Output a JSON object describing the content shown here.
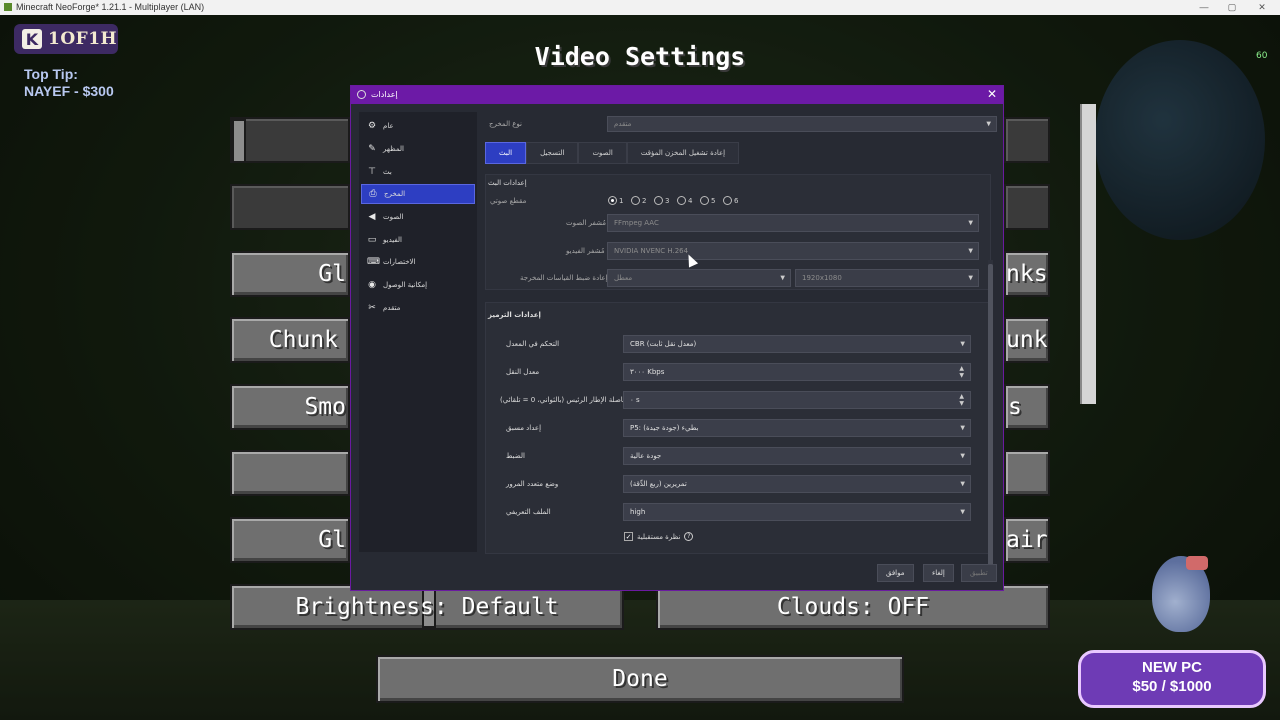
{
  "window": {
    "title": "Minecraft NeoForge* 1.21.1 - Multiplayer (LAN)",
    "controls": {
      "minimize": "—",
      "maximize": "▢",
      "close": "✕"
    }
  },
  "overlay": {
    "logo_text": "1OF1H",
    "top_tip_label": "Top Tip:",
    "top_tip_value": "NAYEF - $300",
    "fps": "60",
    "promo_line1": "NEW PC",
    "promo_line2": "$50 / $1000"
  },
  "minecraft": {
    "title": "Video Settings",
    "buttons": {
      "left_row3": "Gl",
      "right_row3": "nks",
      "left_row4": "Chunk",
      "right_row4": "unks",
      "left_row5": "Smo",
      "right_row5": "s",
      "left_row7": "Gl",
      "right_row7": "air",
      "brightness": "Brightness: Default",
      "clouds": "Clouds: OFF",
      "done": "Done"
    }
  },
  "dialog": {
    "title": "إعدادات",
    "close": "✕",
    "sidebar": [
      {
        "label": "عام",
        "icon": "gear-icon",
        "glyph": "⚙"
      },
      {
        "label": "المظهر",
        "icon": "brush-icon",
        "glyph": "✎"
      },
      {
        "label": "بث",
        "icon": "antenna-icon",
        "glyph": "⊤"
      },
      {
        "label": "المخرج",
        "icon": "output-icon",
        "glyph": "⎙"
      },
      {
        "label": "الصوت",
        "icon": "speaker-icon",
        "glyph": "◀"
      },
      {
        "label": "الفيديو",
        "icon": "monitor-icon",
        "glyph": "▭"
      },
      {
        "label": "الاختصارات",
        "icon": "keyboard-icon",
        "glyph": "⌨"
      },
      {
        "label": "إمكانية الوصول",
        "icon": "accessibility-icon",
        "glyph": "◉"
      },
      {
        "label": "متقدم",
        "icon": "tools-icon",
        "glyph": "✂"
      }
    ],
    "output_mode_label": "نوع المخرج",
    "output_mode_value": "متقدم",
    "tabs": [
      "البث",
      "التسجيل",
      "الصوت",
      "إعادة تشغيل المخزن المؤقت"
    ],
    "stream_section_title": "إعدادات البث",
    "audio_track_label": "مقطع صوتي",
    "audio_tracks": [
      "1",
      "2",
      "3",
      "4",
      "5",
      "6"
    ],
    "audio_encoder_label": "مُشفر الصوت",
    "audio_encoder_value": "FFmpeg AAC",
    "video_encoder_label": "مُشفر الفيديو",
    "video_encoder_value": "NVIDIA NVENC H.264",
    "rescale_label": "إعادة ضبط القياسات المخرجة",
    "rescale_value": "معطل",
    "rescale_resolution": "1920x1080",
    "encoder_section_title": "إعدادات الترميز",
    "rate_control_label": "التحكم في المعدل",
    "rate_control_value": "CBR (معدل نقل ثابت)",
    "bitrate_label": "معدل النقل",
    "bitrate_value": "٣٠٠٠ Kbps",
    "keyframe_label": "فاصلة الإطار الرئيس (بالثواني، 0 = تلقائي)",
    "keyframe_value": "٠ s",
    "preset_label": "إعداد مسبق",
    "preset_value": "P5: بطيء (جودة جيدة)",
    "tuning_label": "الضبط",
    "tuning_value": "جودة عالية",
    "multipass_label": "وضع متعدد المرور",
    "multipass_value": "تمريرين (ربع الدِّقة)",
    "profile_label": "الملف التعريفي",
    "profile_value": "high",
    "lookahead_label": "نظرة مستقبلية",
    "footer": {
      "ok": "موافق",
      "cancel": "إلغاء",
      "apply": "تطبيق"
    }
  }
}
